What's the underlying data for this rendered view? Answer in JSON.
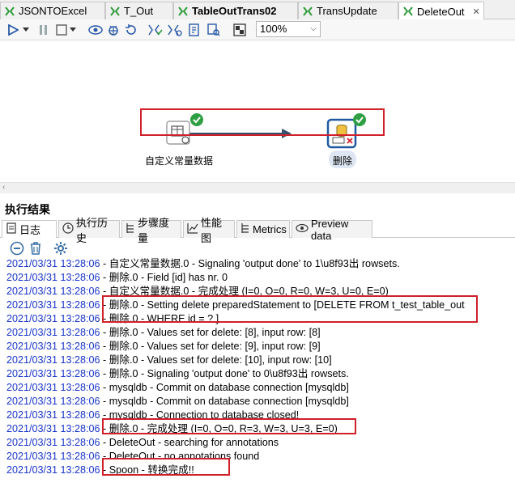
{
  "tabs": [
    {
      "label": "JSONTOExcel",
      "bold": false,
      "active": false
    },
    {
      "label": "T_Out",
      "bold": false,
      "active": false
    },
    {
      "label": "TableOutTrans02",
      "bold": true,
      "active": false
    },
    {
      "label": "TransUpdate",
      "bold": false,
      "active": false
    },
    {
      "label": "DeleteOut",
      "bold": false,
      "active": true
    }
  ],
  "toolbar": {
    "zoom": "100%"
  },
  "canvas": {
    "node_source_label": "自定义常量数据",
    "node_delete_label": "删除"
  },
  "results": {
    "title": "执行结果",
    "tabs": [
      "日志",
      "执行历史",
      "步骤度量",
      "性能图",
      "Metrics",
      "Preview data"
    ]
  },
  "log": [
    {
      "ts": "2021/03/31 13:28:06",
      "msg": " - 自定义常量数据.0 - Signaling 'output done' to 1\\u8f93出 rowsets."
    },
    {
      "ts": "2021/03/31 13:28:06",
      "msg": " - 删除.0 - Field [id] has nr. 0"
    },
    {
      "ts": "2021/03/31 13:28:06",
      "msg": " - 自定义常量数据.0 - 完成处理 (I=0, O=0, R=0, W=3, U=0, E=0)"
    },
    {
      "ts": "2021/03/31 13:28:06",
      "msg": " - 删除.0 - Setting delete preparedStatement to [DELETE FROM t_test_table_out"
    },
    {
      "ts": "2021/03/31 13:28:06",
      "msg": " - 删除.0 - WHERE id = ? ]"
    },
    {
      "ts": "2021/03/31 13:28:06",
      "msg": " - 删除.0 - Values set for delete: [8], input row: [8]"
    },
    {
      "ts": "2021/03/31 13:28:06",
      "msg": " - 删除.0 - Values set for delete: [9], input row: [9]"
    },
    {
      "ts": "2021/03/31 13:28:06",
      "msg": " - 删除.0 - Values set for delete: [10], input row: [10]"
    },
    {
      "ts": "2021/03/31 13:28:06",
      "msg": " - 删除.0 - Signaling 'output done' to 0\\u8f93出 rowsets."
    },
    {
      "ts": "2021/03/31 13:28:06",
      "msg": " - mysqldb - Commit on database connection [mysqldb]"
    },
    {
      "ts": "2021/03/31 13:28:06",
      "msg": " - mysqldb - Commit on database connection [mysqldb]"
    },
    {
      "ts": "2021/03/31 13:28:06",
      "msg": " - mysqldb - Connection to database closed!"
    },
    {
      "ts": "2021/03/31 13:28:06",
      "msg": " - 删除.0 - 完成处理 (I=0, O=0, R=3, W=3, U=3, E=0)"
    },
    {
      "ts": "2021/03/31 13:28:06",
      "msg": " - DeleteOut - searching for annotations"
    },
    {
      "ts": "2021/03/31 13:28:06",
      "msg": " - DeleteOut - no annotations found"
    },
    {
      "ts": "2021/03/31 13:28:06",
      "msg": " - Spoon - 转换完成!!"
    }
  ],
  "colors": {
    "timestamp": "#1a35c8",
    "highlight": "#d0202a",
    "accent": "#3a6ea5",
    "success": "#2ea043"
  }
}
